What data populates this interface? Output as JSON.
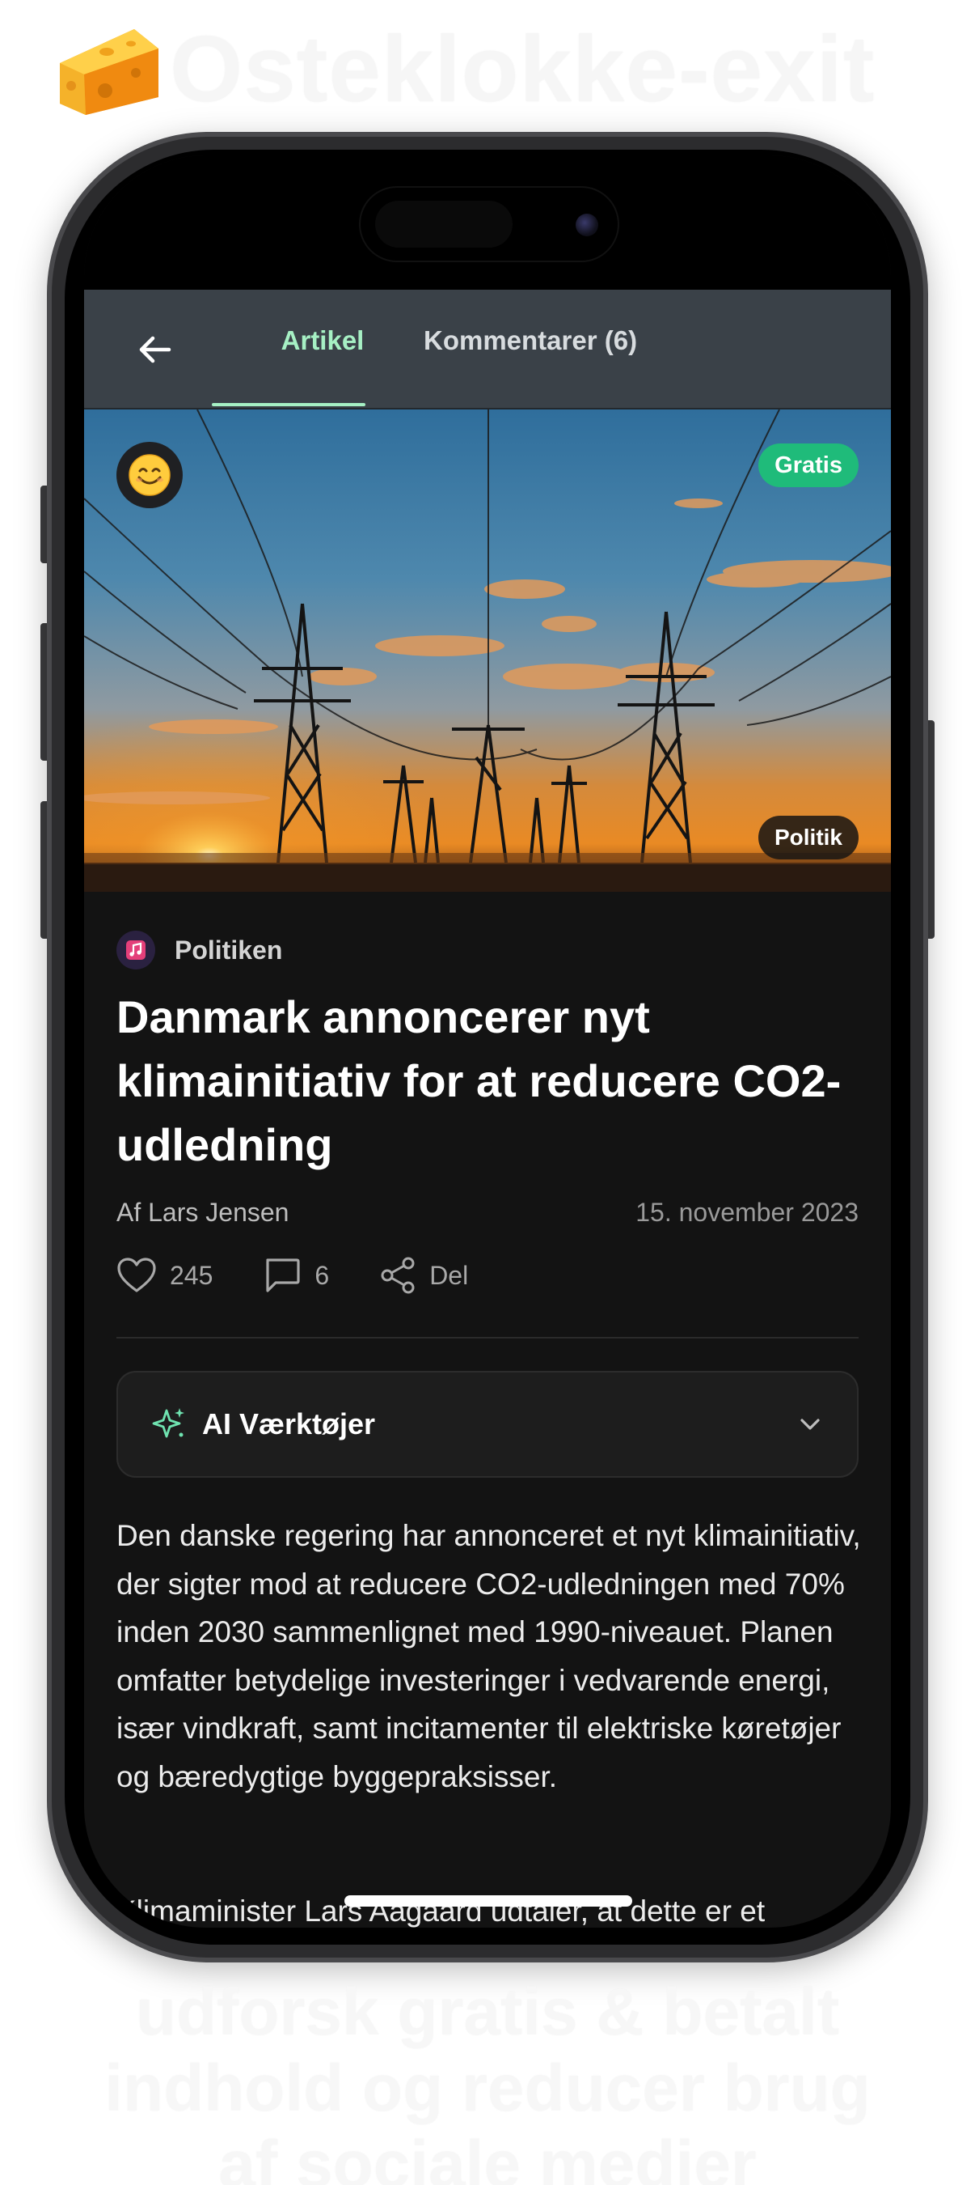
{
  "header": {
    "brand_title": "Osteklokke-exit",
    "logo_icon": "cheese-icon"
  },
  "nav": {
    "back_icon": "arrow-left-icon",
    "tabs": [
      {
        "label": "Artikel",
        "active": true
      },
      {
        "label": "Kommentarer (6)",
        "active": false
      }
    ],
    "active_color": "#a6f0c4",
    "background": "#3a4148"
  },
  "hero": {
    "avatar_emoji": "😊",
    "access_badge": "Gratis",
    "access_badge_color": "#1fbb7a",
    "category_badge": "Politik"
  },
  "article": {
    "source_icon": "music-note-icon",
    "source": "Politiken",
    "headline": "Danmark annoncerer nyt klimainitiativ for at reducere CO2-udledning",
    "byline": "Af Lars Jensen",
    "date": "15. november 2023",
    "paragraph_1": "Den danske regering har annonceret et nyt klimainitiativ, der sigter mod at reducere CO2-udledningen med 70% inden 2030 sammenlignet med 1990-niveauet. Planen omfatter betydelige investeringer i vedvarende energi, især vindkraft, samt incitamenter til elektriske køretøjer og bæredygtige byggepraksisser.",
    "paragraph_2_partial": "Klimaminister Lars Aagaard udtaler, at dette er et"
  },
  "actions": {
    "likes": {
      "icon": "heart-icon",
      "count": "245"
    },
    "comments": {
      "icon": "comment-icon",
      "count": "6"
    },
    "share": {
      "icon": "share-icon",
      "label": "Del"
    }
  },
  "ai_tools": {
    "icon": "sparkles-icon",
    "title": "AI Værktøjer",
    "toggle_icon": "chevron-down-icon"
  },
  "footer": {
    "tagline": "udforsk gratis & betalt indhold og reducer brug af sociale medier"
  }
}
